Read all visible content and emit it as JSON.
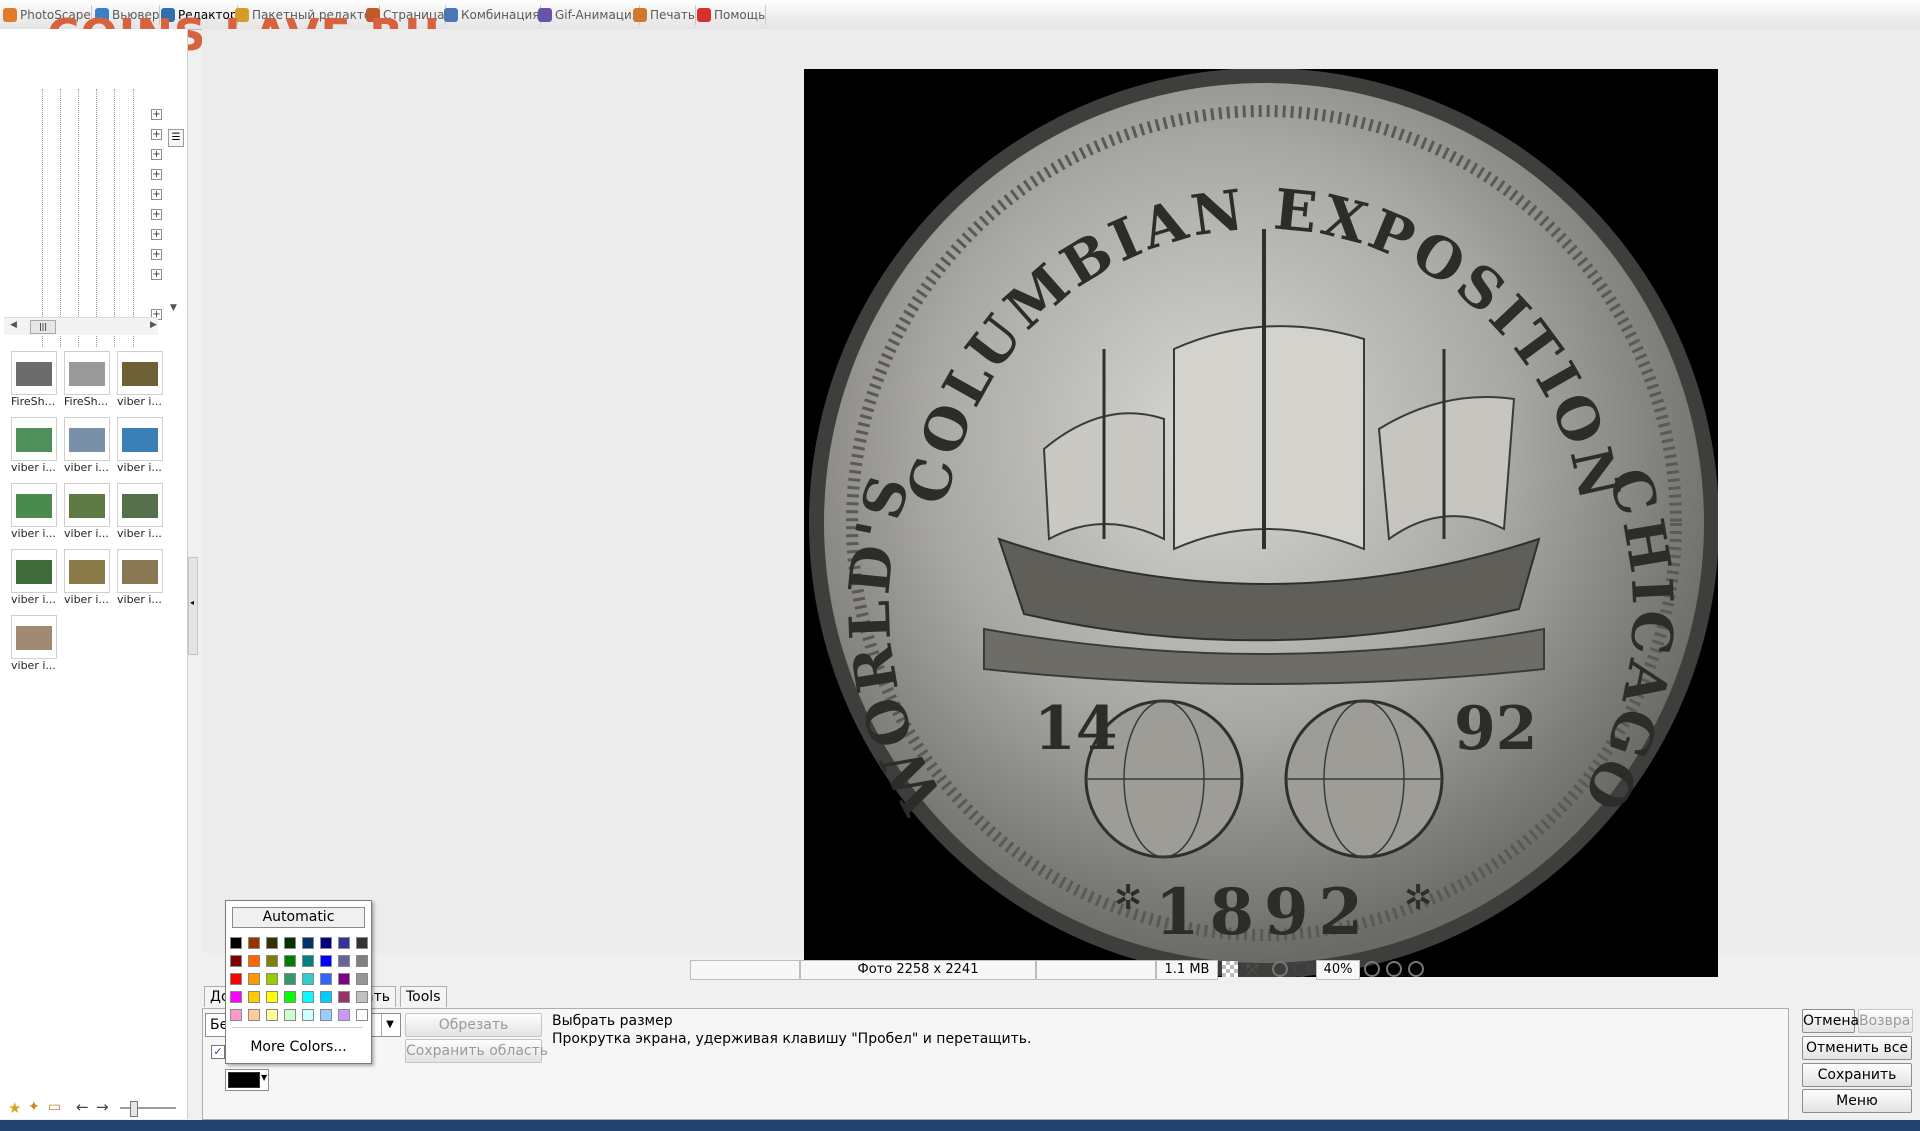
{
  "tabs": [
    {
      "label": "PhotoScape",
      "icon": "photoscape-icon",
      "color": "#e07b2c"
    },
    {
      "label": "Вьювер",
      "icon": "viewer-icon",
      "color": "#3d7fc6"
    },
    {
      "label": "Редактор",
      "icon": "editor-icon",
      "color": "#2f6fb0"
    },
    {
      "label": "Пакетный редактор",
      "icon": "batch-editor-icon",
      "color": "#d69b2a"
    },
    {
      "label": "Страница",
      "icon": "page-icon",
      "color": "#c05a2a"
    },
    {
      "label": "Комбинация",
      "icon": "combine-icon",
      "color": "#4a77b4"
    },
    {
      "label": "Gif-Анимация",
      "icon": "gif-icon",
      "color": "#6a52a8"
    },
    {
      "label": "Печать",
      "icon": "print-icon",
      "color": "#d0782c"
    },
    {
      "label": "Помощь",
      "icon": "help-icon",
      "color": "#d8302a"
    }
  ],
  "active_tab": "Редактор",
  "watermark": "COINS.LAVE.RU",
  "thumbnails": [
    {
      "caption": "FireSh...",
      "tone": "#6b6b6b"
    },
    {
      "caption": "FireSh...",
      "tone": "#9a9a9a"
    },
    {
      "caption": "viber i...",
      "tone": "#6e6138"
    },
    {
      "caption": "viber i...",
      "tone": "#4f8f5a"
    },
    {
      "caption": "viber i...",
      "tone": "#7a90a8"
    },
    {
      "caption": "viber i...",
      "tone": "#3a7fb5"
    },
    {
      "caption": "viber i...",
      "tone": "#4a8a4f"
    },
    {
      "caption": "viber i...",
      "tone": "#5d7a44"
    },
    {
      "caption": "viber i...",
      "tone": "#55704a"
    },
    {
      "caption": "viber i...",
      "tone": "#3f6a3a"
    },
    {
      "caption": "viber i...",
      "tone": "#8a7a4a"
    },
    {
      "caption": "viber i...",
      "tone": "#8a7855"
    },
    {
      "caption": "viber i...",
      "tone": "#a08a70"
    }
  ],
  "coin": {
    "top_text": "COLUMBIAN EXPOSITION",
    "left_text": "WORLD'S",
    "right_text": "CHICAGO",
    "year_left": "14",
    "year_right": "92",
    "date": "1892"
  },
  "status": {
    "dimensions": "Фото 2258 x 2241",
    "filesize": "1.1 MB",
    "zoom": "40%"
  },
  "bottom_tabs": [
    "До",
    "ать",
    "Tools"
  ],
  "crop": {
    "select_value": "Бе",
    "crop_button": "Обрезать",
    "save_area_button": "Сохранить область",
    "hint_line1": "Выбрать размер",
    "hint_line2": "Прокрутка экрана, удерживая клавишу \"Пробел\" и перетащить."
  },
  "right_buttons": {
    "undo": "Отмена",
    "redo": "Возврат",
    "undo_all": "Отменить все",
    "save": "Сохранить",
    "menu": "Меню"
  },
  "color_popup": {
    "automatic": "Automatic",
    "more_colors": "More Colors...",
    "selected_color": "#000000",
    "palette": [
      [
        "#000000",
        "#993300",
        "#333300",
        "#003300",
        "#003366",
        "#000080",
        "#333399",
        "#333333"
      ],
      [
        "#800000",
        "#ff6600",
        "#808000",
        "#008000",
        "#008080",
        "#0000ff",
        "#666699",
        "#808080"
      ],
      [
        "#ff0000",
        "#ff9900",
        "#99cc00",
        "#339966",
        "#33cccc",
        "#3366ff",
        "#800080",
        "#969696"
      ],
      [
        "#ff00ff",
        "#ffcc00",
        "#ffff00",
        "#00ff00",
        "#00ffff",
        "#00ccff",
        "#993366",
        "#c0c0c0"
      ],
      [
        "#ff99cc",
        "#ffcc99",
        "#ffff99",
        "#ccffcc",
        "#ccffff",
        "#99ccff",
        "#cc99ff",
        "#ffffff"
      ]
    ]
  }
}
